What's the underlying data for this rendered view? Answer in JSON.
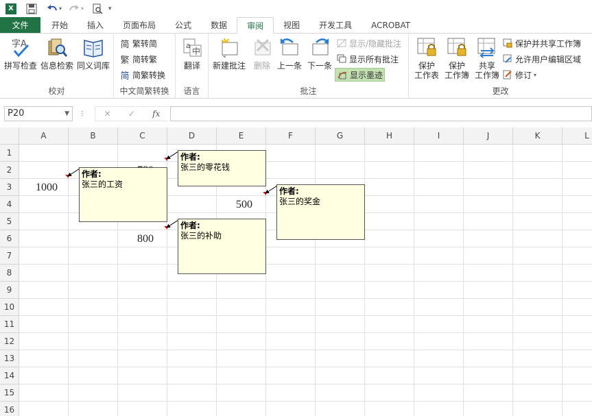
{
  "qat": {
    "logo": "X",
    "save_icon": "save-icon",
    "undo_icon": "undo-icon",
    "redo_icon": "redo-icon",
    "preview_icon": "print-preview-icon"
  },
  "tabs": [
    {
      "label": "文件"
    },
    {
      "label": "开始"
    },
    {
      "label": "插入"
    },
    {
      "label": "页面布局"
    },
    {
      "label": "公式"
    },
    {
      "label": "数据"
    },
    {
      "label": "审阅"
    },
    {
      "label": "视图"
    },
    {
      "label": "开发工具"
    },
    {
      "label": "ACROBAT"
    }
  ],
  "ribbon": {
    "proofing": {
      "label": "校对",
      "spell": "拼写检查",
      "research": "信息检索",
      "thesaurus": "同义词库"
    },
    "chinese": {
      "label": "中文简繁转换",
      "to_simplified": "繁转简",
      "to_traditional": "简转繁",
      "convert": "简繁转换"
    },
    "language": {
      "label": "语言",
      "translate": "翻译"
    },
    "comments": {
      "label": "批注",
      "new": "新建批注",
      "delete": "删除",
      "prev": "上一条",
      "next": "下一条",
      "show_hide": "显示/隐藏批注",
      "show_all": "显示所有批注",
      "show_ink": "显示墨迹"
    },
    "changes": {
      "label": "更改",
      "protect_sheet_1": "保护",
      "protect_sheet_2": "工作表",
      "protect_wb_1": "保护",
      "protect_wb_2": "工作簿",
      "share_1": "共享",
      "share_2": "工作簿",
      "protect_share": "保护并共享工作簿",
      "allow_edit": "允许用户编辑区域",
      "track": "修订"
    }
  },
  "formula_bar": {
    "name_box": "P20",
    "fx": "fx",
    "cancel": "✕",
    "enter": "✓",
    "formula": ""
  },
  "columns": [
    "A",
    "B",
    "C",
    "D",
    "E",
    "F",
    "G",
    "H",
    "I",
    "J",
    "K",
    "L"
  ],
  "rows": [
    "1",
    "2",
    "3",
    "4",
    "5",
    "6",
    "7",
    "8",
    "9",
    "10",
    "11",
    "12",
    "13",
    "14",
    "15",
    "16"
  ],
  "cells": {
    "A3": "1000",
    "C2": "780",
    "E4": "500",
    "C6": "800"
  },
  "comments": [
    {
      "author": "作者:",
      "text": "张三的工资"
    },
    {
      "author": "作者:",
      "text": "张三的零花钱"
    },
    {
      "author": "作者:",
      "text": "张三的奖金"
    },
    {
      "author": "作者:",
      "text": "张三的补助"
    }
  ],
  "colors": {
    "file_tab": "#217346",
    "comment_bg": "#ffffe1",
    "marker": "#e11111",
    "accent": "#217346"
  }
}
